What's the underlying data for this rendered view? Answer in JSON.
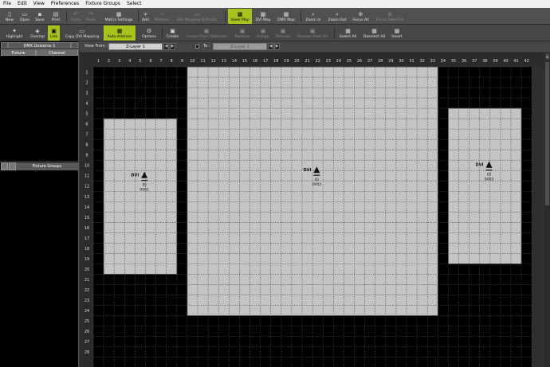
{
  "menu": [
    "File",
    "Edit",
    "View",
    "Preferences",
    "Fixture Groups",
    "Select"
  ],
  "toolbar1": {
    "new": "New",
    "open": "Open",
    "save": "Save",
    "print": "Print",
    "undo": "Undo",
    "redo": "Redo",
    "matrix_settings": "Matrix Settings",
    "add": "Add",
    "remove": "Remove",
    "dvi_mapping_defaults": "DVI Mapping Defaults",
    "voxel_map": "Voxel Map",
    "dvi_map": "DVI Map",
    "dmx_map": "DMX Map",
    "zoom_in": "Zoom In",
    "zoom_out": "Zoom Out",
    "focus_all": "Focus All",
    "focus_selected": "Focus Selected"
  },
  "toolbar2": {
    "highlight": "Highlight",
    "overlap": "Overlap",
    "link": "Link",
    "copy_dvi_mapping": "Copy DVI Mapping",
    "auto_address": "Auto-Address",
    "options": "Options",
    "create": "Create",
    "create_from_selection": "Create From Selection",
    "remove": "Remove",
    "assign": "Assign",
    "release": "Release",
    "release_from_all": "Release From All",
    "select_all": "Select All",
    "deselect_all": "Deselect All",
    "invert": "Invert"
  },
  "dmx_panel": {
    "title": "DMX Universe 1",
    "columns": [
      "Fixture",
      "Channel"
    ]
  },
  "fixture_groups_panel": {
    "title": "Fixture Groups"
  },
  "view_bar": {
    "view_from_label": "View From :",
    "view_from_value": "Z-Layer 1",
    "to_label": "To :",
    "to_value": "Z-Layer 1"
  },
  "grid": {
    "columns": 42,
    "rows": 28,
    "col_labels": [
      "1",
      "2",
      "3",
      "4",
      "5",
      "6",
      "7",
      "8",
      "9",
      "10",
      "11",
      "12",
      "13",
      "14",
      "15",
      "16",
      "17",
      "18",
      "19",
      "20",
      "21",
      "22",
      "23",
      "24",
      "25",
      "26",
      "27",
      "28",
      "29",
      "30",
      "31",
      "32",
      "33",
      "34",
      "35",
      "36",
      "37",
      "38",
      "39",
      "40",
      "41",
      "42"
    ],
    "row_labels": [
      "1",
      "2",
      "3",
      "4",
      "5",
      "6",
      "7",
      "8",
      "9",
      "10",
      "11",
      "12",
      "13",
      "14",
      "15",
      "16",
      "17",
      "18",
      "19",
      "20",
      "21",
      "22",
      "23",
      "24",
      "25",
      "26",
      "27",
      "28"
    ]
  },
  "fixtures": [
    {
      "type": "DVI",
      "id_label": "ID",
      "id": "0001",
      "col_start": 1,
      "col_end": 8,
      "row_start": 5,
      "row_end": 20
    },
    {
      "type": "DVI",
      "id_label": "ID",
      "id": "0002",
      "col_start": 9,
      "col_end": 33,
      "row_start": 0,
      "row_end": 24
    },
    {
      "type": "DVI",
      "id_label": "ID",
      "id": "0003",
      "col_start": 34,
      "col_end": 41,
      "row_start": 4,
      "row_end": 19
    }
  ],
  "colors": {
    "accent": "#a7c41c",
    "fixture_fill": "#c4c4c4",
    "grid_bg": "#000000"
  }
}
